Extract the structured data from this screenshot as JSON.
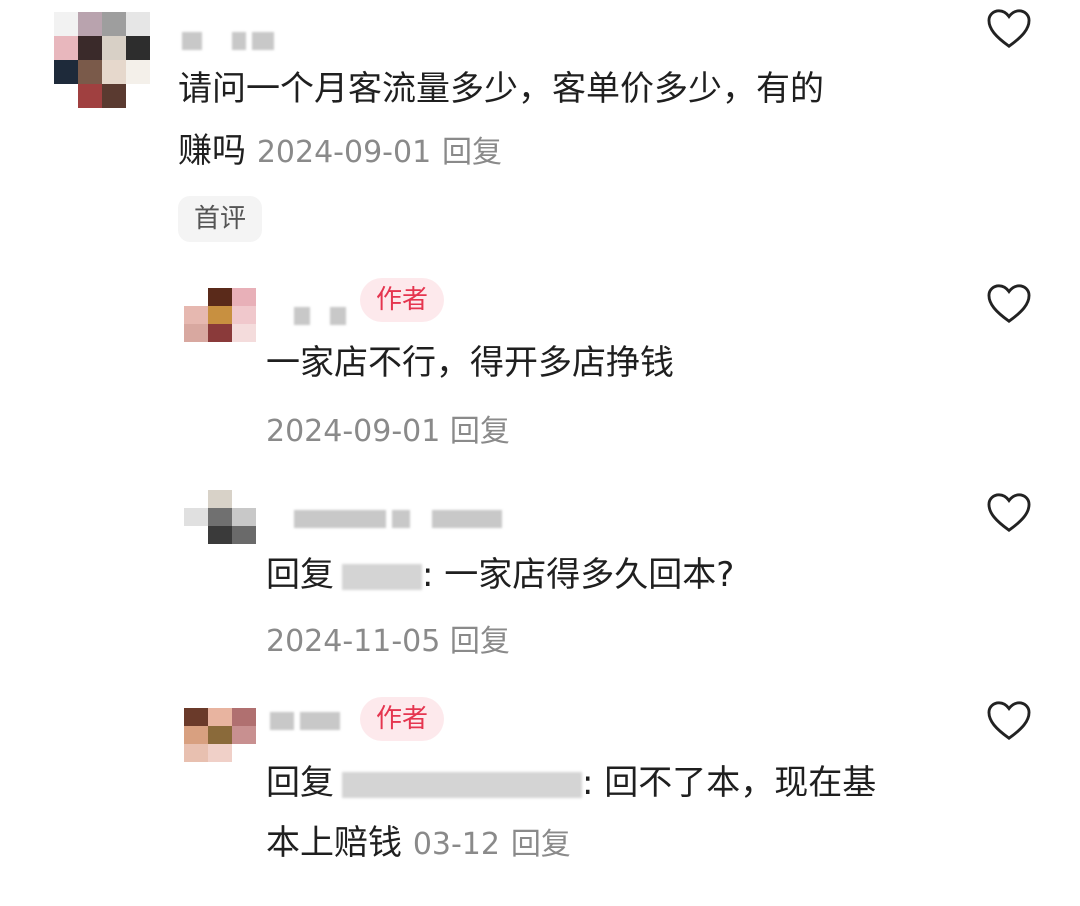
{
  "comments": [
    {
      "text_line1": "请问一个月客流量多少，客单价多少，有的",
      "text_line2_prefix": "赚吗",
      "date": "2024-09-01",
      "reply_label": "回复",
      "tag": "首评"
    },
    {
      "author_badge": "作者",
      "text": "一家店不行，得开多店挣钱",
      "date": "2024-09-01",
      "reply_label": "回复"
    },
    {
      "reply_prefix": "回复",
      "text": ": 一家店得多久回本?",
      "date": "2024-11-05",
      "reply_label": "回复"
    },
    {
      "author_badge": "作者",
      "reply_prefix": "回复",
      "text_line1": ": 回不了本，现在基",
      "text_line2": "本上赔钱",
      "date": "03-12",
      "reply_label": "回复"
    }
  ],
  "icons": {
    "like": "heart-outline-icon"
  },
  "colors": {
    "author_badge_bg": "#fde9ec",
    "author_badge_text": "#e5354f",
    "meta": "#8a8a8a"
  }
}
